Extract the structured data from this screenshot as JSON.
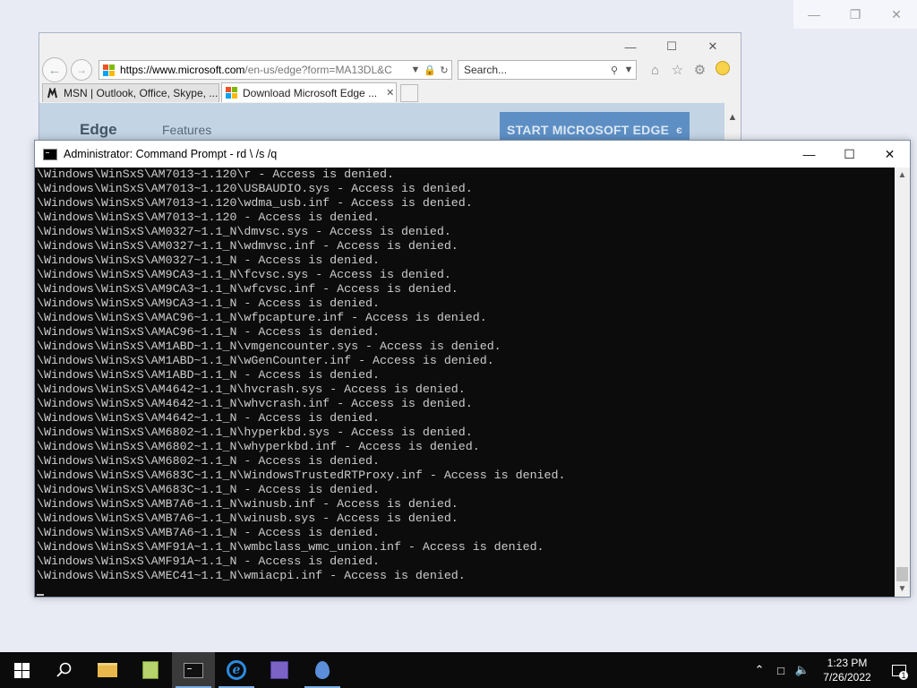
{
  "desktop": {
    "controls": [
      "—",
      "❐",
      "✕"
    ]
  },
  "ie": {
    "caption_buttons": [
      "—",
      "☐",
      "✕"
    ],
    "url_domain": "https://www.microsoft.com",
    "url_rest": "/en-us/edge?form=MA13DL&C",
    "search_placeholder": "Search...",
    "tabs": [
      {
        "label": "MSN | Outlook, Office, Skype, ..."
      },
      {
        "label": "Download Microsoft Edge ..."
      }
    ],
    "page": {
      "brand": "Edge",
      "nav_features": "Features",
      "start_button": "START MICROSOFT EDGE"
    },
    "ms_logo_colors": [
      "#f25022",
      "#7fba00",
      "#00a4ef",
      "#ffb900"
    ]
  },
  "cmd": {
    "title": "Administrator: Command Prompt - rd  \\ /s /q",
    "caption_buttons": [
      "—",
      "☐",
      "✕"
    ],
    "lines": [
      "\\Windows\\WinSxS\\AM7013~1.120\\r - Access is denied.",
      "\\Windows\\WinSxS\\AM7013~1.120\\USBAUDIO.sys - Access is denied.",
      "\\Windows\\WinSxS\\AM7013~1.120\\wdma_usb.inf - Access is denied.",
      "\\Windows\\WinSxS\\AM7013~1.120 - Access is denied.",
      "\\Windows\\WinSxS\\AM0327~1.1_N\\dmvsc.sys - Access is denied.",
      "\\Windows\\WinSxS\\AM0327~1.1_N\\wdmvsc.inf - Access is denied.",
      "\\Windows\\WinSxS\\AM0327~1.1_N - Access is denied.",
      "\\Windows\\WinSxS\\AM9CA3~1.1_N\\fcvsc.sys - Access is denied.",
      "\\Windows\\WinSxS\\AM9CA3~1.1_N\\wfcvsc.inf - Access is denied.",
      "\\Windows\\WinSxS\\AM9CA3~1.1_N - Access is denied.",
      "\\Windows\\WinSxS\\AMAC96~1.1_N\\wfpcapture.inf - Access is denied.",
      "\\Windows\\WinSxS\\AMAC96~1.1_N - Access is denied.",
      "\\Windows\\WinSxS\\AM1ABD~1.1_N\\vmgencounter.sys - Access is denied.",
      "\\Windows\\WinSxS\\AM1ABD~1.1_N\\wGenCounter.inf - Access is denied.",
      "\\Windows\\WinSxS\\AM1ABD~1.1_N - Access is denied.",
      "\\Windows\\WinSxS\\AM4642~1.1_N\\hvcrash.sys - Access is denied.",
      "\\Windows\\WinSxS\\AM4642~1.1_N\\whvcrash.inf - Access is denied.",
      "\\Windows\\WinSxS\\AM4642~1.1_N - Access is denied.",
      "\\Windows\\WinSxS\\AM6802~1.1_N\\hyperkbd.sys - Access is denied.",
      "\\Windows\\WinSxS\\AM6802~1.1_N\\whyperkbd.inf - Access is denied.",
      "\\Windows\\WinSxS\\AM6802~1.1_N - Access is denied.",
      "\\Windows\\WinSxS\\AM683C~1.1_N\\WindowsTrustedRTProxy.inf - Access is denied.",
      "\\Windows\\WinSxS\\AM683C~1.1_N - Access is denied.",
      "\\Windows\\WinSxS\\AMB7A6~1.1_N\\winusb.inf - Access is denied.",
      "\\Windows\\WinSxS\\AMB7A6~1.1_N\\winusb.sys - Access is denied.",
      "\\Windows\\WinSxS\\AMB7A6~1.1_N - Access is denied.",
      "\\Windows\\WinSxS\\AMF91A~1.1_N\\wmbclass_wmc_union.inf - Access is denied.",
      "\\Windows\\WinSxS\\AMF91A~1.1_N - Access is denied.",
      "\\Windows\\WinSxS\\AMEC41~1.1_N\\wmiacpi.inf - Access is denied."
    ]
  },
  "taskbar": {
    "clock_time": "1:23 PM",
    "clock_date": "7/26/2022",
    "notification_count": "1"
  }
}
